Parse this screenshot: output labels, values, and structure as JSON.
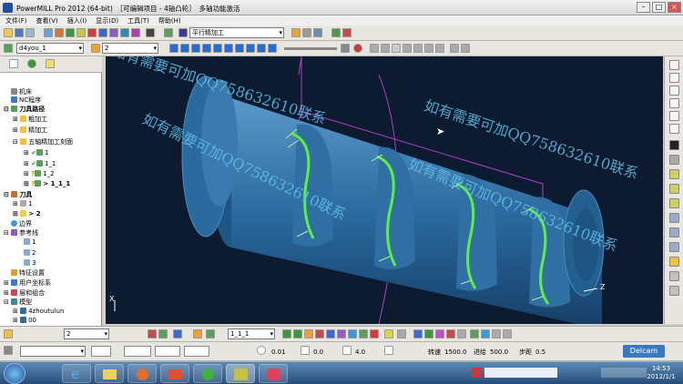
{
  "window": {
    "title": "PowerMILL Pro 2012 (64-bit)　［可编辑项目 - 4轴凸轮］　多轴功能激活"
  },
  "menu": [
    "文件(F)",
    "查看(V)",
    "插入(I)",
    "显示(D)",
    "工具(T)",
    "帮助(H)"
  ],
  "toolbar": {
    "strategy_combo": "平行精加工",
    "toolpath_combo": "d4you_1",
    "num_combo": "2"
  },
  "tree": {
    "machine": "机床",
    "nc": "NC程序",
    "toolpaths": "刀具路径",
    "rough": "粗加工",
    "finish": "精加工",
    "threeaxis": "五轴精加工刻面",
    "tp1": "1",
    "tp2": "1_1",
    "tp3": "1_2",
    "tp4": "> 1_1_1",
    "tools": "刀具",
    "tool1": "1",
    "tool2": "> 2",
    "boundary": "边界",
    "pattern": "参考线",
    "p1": "1",
    "p2": "2",
    "p3": "3",
    "features": "特征设置",
    "ucs": "用户坐标系",
    "levels": "层和组合",
    "models": "模型",
    "m1": "4zhoutulun",
    "m2": "00"
  },
  "viewport": {
    "watermark": "如有需要可加QQ758632610联系",
    "axis_x": "X",
    "axis_z": "Z"
  },
  "bottom": {
    "tp_combo": "1_1_1",
    "num2": "2",
    "tol_val": "0.01",
    "thick_val": "0.0",
    "step_val": "4.0",
    "speed_label": "转速",
    "speed_val": "1500.0",
    "feed_label": "进给",
    "feed_val": "500.0",
    "stepover_label": "步距",
    "stepover_val": "0.5",
    "brand": "Delcam"
  },
  "clock": {
    "time": "14:53",
    "date": "2012/1/1"
  }
}
